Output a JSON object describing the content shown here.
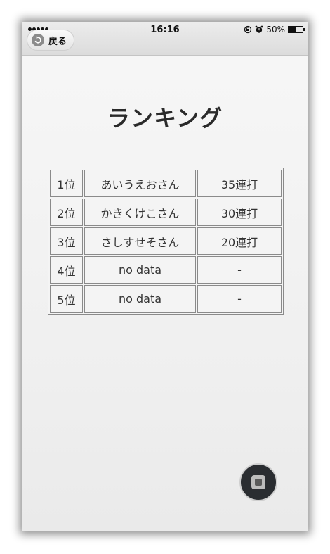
{
  "status_bar": {
    "time": "16:16",
    "battery_text": "50%",
    "battery_level": 0.5,
    "icons": [
      "signal-dots-icon",
      "rotation-lock-icon",
      "alarm-icon",
      "battery-icon"
    ]
  },
  "nav": {
    "back_label": "戻る",
    "back_icon": "back-arrow-icon"
  },
  "page": {
    "title": "ランキング"
  },
  "ranking": {
    "rows": [
      {
        "rank": "1位",
        "name": "あいうえおさん",
        "score": "35連打"
      },
      {
        "rank": "2位",
        "name": "かきくけこさん",
        "score": "30連打"
      },
      {
        "rank": "3位",
        "name": "さしすせそさん",
        "score": "20連打"
      },
      {
        "rank": "4位",
        "name": "no data",
        "score": "-"
      },
      {
        "rank": "5位",
        "name": "no data",
        "score": "-"
      }
    ]
  },
  "assistive_touch": {
    "icon": "assistive-touch-icon"
  }
}
